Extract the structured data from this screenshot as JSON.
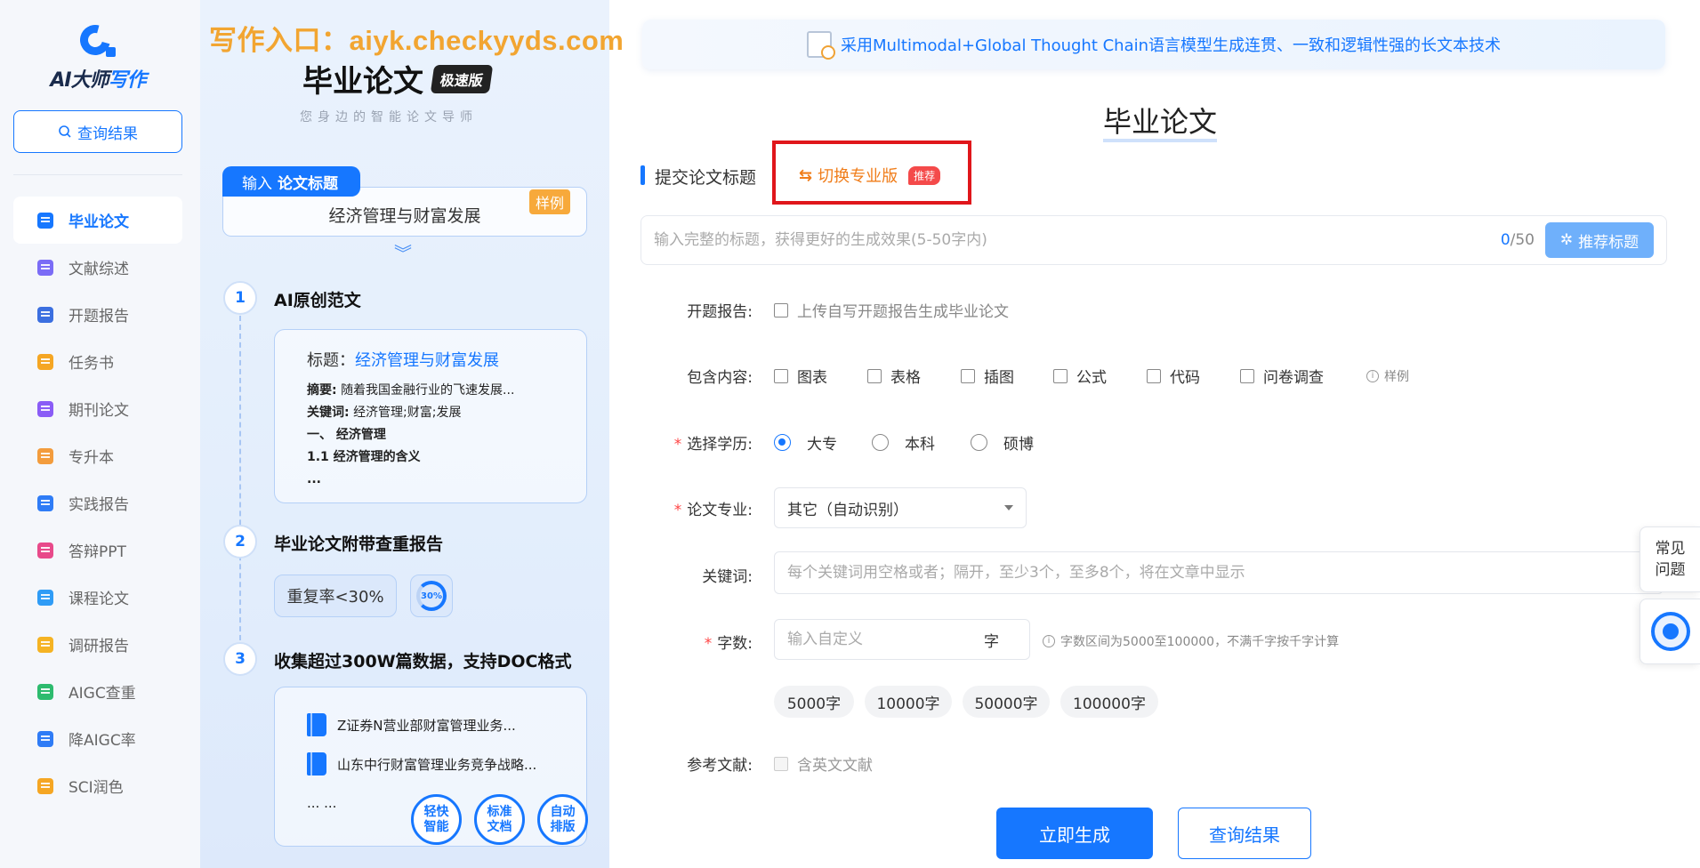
{
  "watermark": "写作入口：aiyk.checkyyds.com",
  "logo": {
    "text_prefix": "AI大师",
    "text_highlight": "写作"
  },
  "sidebar": {
    "query_button": "查询结果",
    "items": [
      {
        "label": "毕业论文",
        "icon": "graduation-cap-icon",
        "color": "#1677ff",
        "active": true
      },
      {
        "label": "文献综述",
        "icon": "document-list-icon",
        "color": "#7b6cf6"
      },
      {
        "label": "开题报告",
        "icon": "report-icon",
        "color": "#3b6fe0"
      },
      {
        "label": "任务书",
        "icon": "task-book-icon",
        "color": "#f5a623"
      },
      {
        "label": "期刊论文",
        "icon": "journal-icon",
        "color": "#8a5cf6"
      },
      {
        "label": "专升本",
        "icon": "upgrade-icon",
        "color": "#f39c3d"
      },
      {
        "label": "实践报告",
        "icon": "practice-icon",
        "color": "#2f7cf6"
      },
      {
        "label": "答辩PPT",
        "icon": "ppt-icon",
        "color": "#e84a8a"
      },
      {
        "label": "课程论文",
        "icon": "course-icon",
        "color": "#2f9cf6"
      },
      {
        "label": "调研报告",
        "icon": "survey-icon",
        "color": "#f5b323"
      },
      {
        "label": "AIGC查重",
        "icon": "aigc-check-icon",
        "color": "#2dbb6e"
      },
      {
        "label": "降AIGC率",
        "icon": "reduce-aigc-icon",
        "color": "#2f7cf6"
      },
      {
        "label": "SCI润色",
        "icon": "sci-polish-icon",
        "color": "#f5a623"
      }
    ]
  },
  "promo": {
    "title": "毕业论文",
    "badge": "极速版",
    "subtitle": "您身边的智能论文导师",
    "input_tab_prefix": "输入",
    "input_tab_bold": "论文标题",
    "sample_title": "经济管理与财富发展",
    "sample_tag": "样例",
    "steps": [
      {
        "num": "1",
        "title": "AI原创范文"
      },
      {
        "num": "2",
        "title": "毕业论文附带查重报告"
      },
      {
        "num": "3",
        "title": "收集超过300W篇数据，支持DOC格式"
      }
    ],
    "card1": {
      "title_label": "标题：",
      "title_value": "经济管理与财富发展",
      "abstract_label": "摘要:",
      "abstract": "随着我国金融行业的飞速发展...",
      "keywords_label": "关键词:",
      "keywords": "经济管理;财富;发展",
      "h1": "一、 经济管理",
      "h2": "1.1 经济管理的含义",
      "ellipsis": "..."
    },
    "dup_rate": "重复率<30%",
    "dup_ring": "30%",
    "card3": {
      "items": [
        "Z证券N营业部财富管理业务...",
        "山东中行财富管理业务竞争战略..."
      ],
      "ellipsis": "... ..."
    },
    "features": [
      "轻快\n智能",
      "标准\n文档",
      "自动\n排版"
    ]
  },
  "banner": "采用Multimodal+Global Thought Chain语言模型生成连贯、一致和逻辑性强的长文本技术",
  "main": {
    "title": "毕业论文",
    "section_label": "提交论文标题",
    "switch_label": "切换专业版",
    "switch_badge": "推荐",
    "title_placeholder": "输入完整的标题，获得更好的生成效果(5-50字内)",
    "counter_current": "0",
    "counter_max": "/50",
    "recommend_button": "推荐标题",
    "proposal": {
      "label": "开题报告:",
      "option": "上传自写开题报告生成毕业论文"
    },
    "include": {
      "label": "包含内容:",
      "options": [
        "图表",
        "表格",
        "插图",
        "公式",
        "代码",
        "问卷调查"
      ],
      "sample": "样例"
    },
    "degree": {
      "label": "选择学历:",
      "options": [
        "大专",
        "本科",
        "硕博"
      ],
      "selected": "大专"
    },
    "major": {
      "label": "论文专业:",
      "value": "其它（自动识别）"
    },
    "keywords": {
      "label": "关键词:",
      "placeholder": "每个关键词用空格或者；隔开，至少3个，至多8个，将在文章中显示"
    },
    "wordcount": {
      "label": "字数:",
      "placeholder": "输入自定义",
      "unit": "字",
      "hint": "字数区间为5000至100000，不满千字按千字计算",
      "presets": [
        "5000字",
        "10000字",
        "50000字",
        "100000字"
      ]
    },
    "references": {
      "label": "参考文献:",
      "option": "含英文文献"
    },
    "generate_button": "立即生成",
    "result_button": "查询结果"
  },
  "float": {
    "faq": "常见\n问题"
  }
}
